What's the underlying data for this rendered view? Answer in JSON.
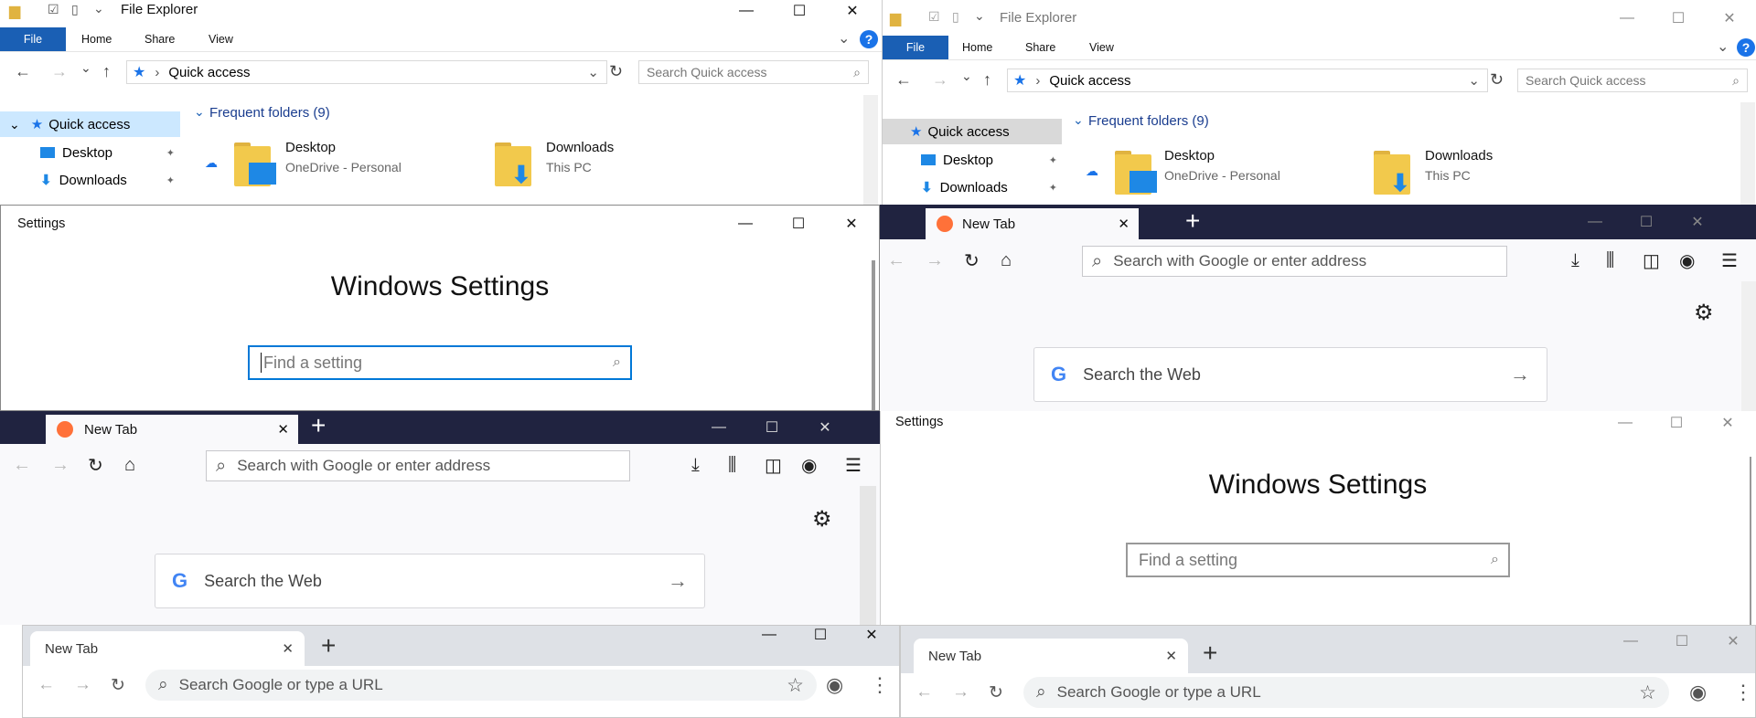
{
  "file_explorer": {
    "title": "File Explorer",
    "ribbon_tabs": [
      "File",
      "Home",
      "Share",
      "View"
    ],
    "address": "Quick access",
    "search_placeholder": "Search Quick access",
    "nav_items": [
      "Quick access",
      "Desktop",
      "Downloads"
    ],
    "section_header": "Frequent folders (9)",
    "folders": [
      {
        "name": "Desktop",
        "location": "OneDrive - Personal"
      },
      {
        "name": "Downloads",
        "location": "This PC"
      }
    ]
  },
  "settings": {
    "title": "Settings",
    "heading": "Windows Settings",
    "search_placeholder": "Find a setting"
  },
  "firefox": {
    "tab_title": "New Tab",
    "url_placeholder": "Search with Google or enter address",
    "web_search": "Search the Web"
  },
  "chrome": {
    "tab_title": "New Tab",
    "omnibox_placeholder": "Search Google or type a URL"
  },
  "glyphs": {
    "minimize": "—",
    "maximize": "☐",
    "close": "✕",
    "back": "←",
    "forward": "→",
    "up": "↑",
    "reload": "↻",
    "dropdown": "⌄",
    "search": "⌕",
    "home": "⌂",
    "gear": "⚙",
    "star": "☆",
    "menu": "☰",
    "more": "⋮",
    "new_tab": "+",
    "pin": "📌",
    "help": "?",
    "chevron": "›",
    "arrow_right": "→",
    "download": "⤓",
    "library": "⫼",
    "sidebar": "◫",
    "account": "◉",
    "google_g": "G"
  },
  "colors": {
    "explorer_file_tab": "#1a5fb4",
    "selection": "#cce8ff",
    "settings_focus": "#0078d7",
    "firefox_tabstrip": "#202340",
    "chrome_strip": "#dee1e6"
  }
}
